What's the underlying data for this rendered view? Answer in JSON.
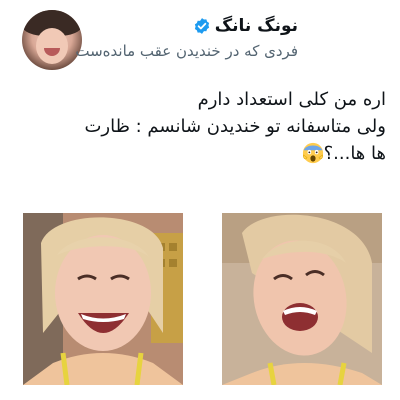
{
  "tweet": {
    "display_name": "نونگ نانگ",
    "handle": "فردی که در خندیدن عقب مانده‌ست",
    "lines": [
      "اره من کلی استعداد دارم",
      "ولی متاسفانه تو خندیدن شانسم : ظارت",
      "ها ها...؟"
    ],
    "emoji": "screaming-face-icon",
    "verified": true
  },
  "colors": {
    "verified": "#1d9bf0",
    "handle": "#536471",
    "text": "#0f1419"
  },
  "media": [
    {
      "name": "photo-left-laughing-woman"
    },
    {
      "name": "photo-right-laughing-woman"
    }
  ]
}
